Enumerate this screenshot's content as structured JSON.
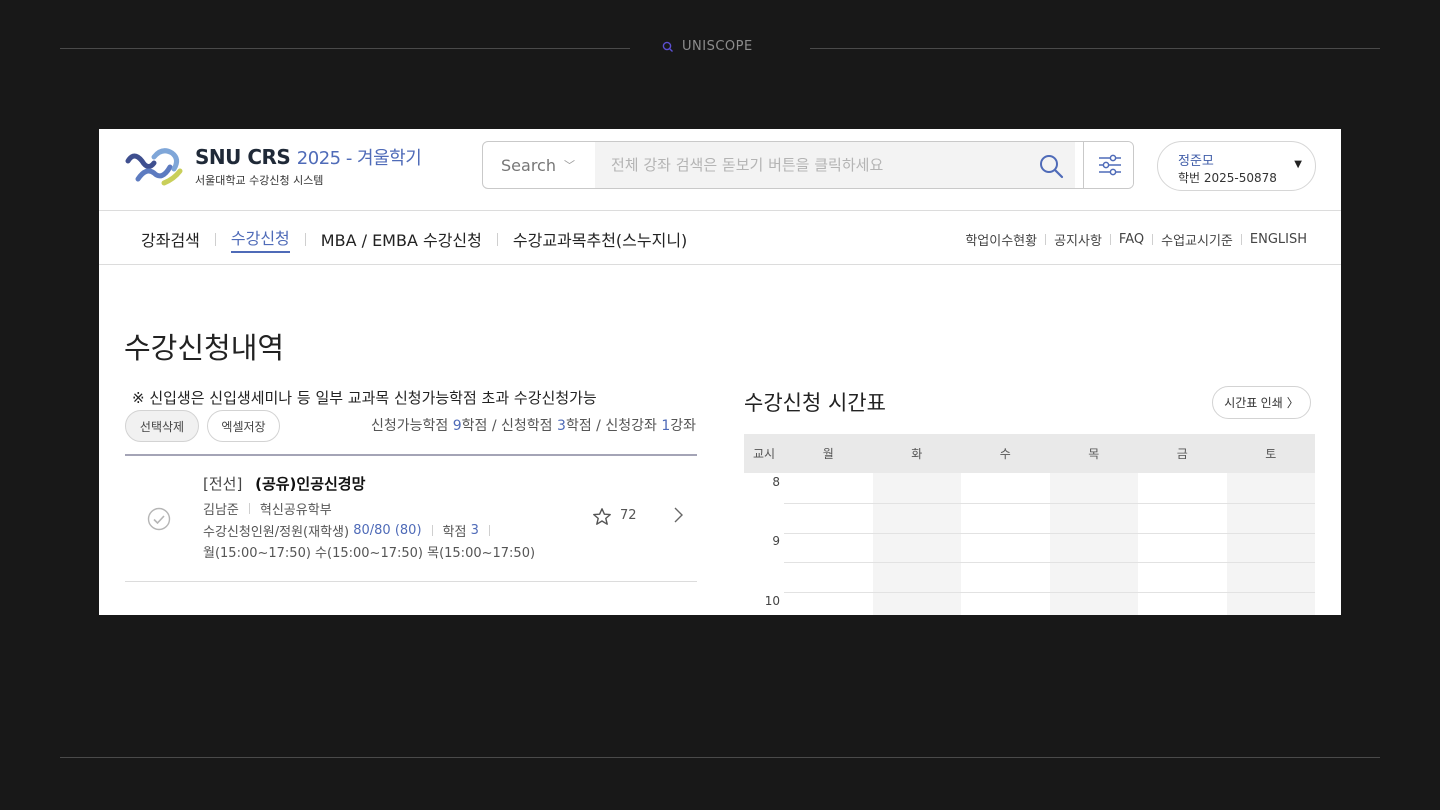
{
  "frame": {
    "brand_label": "UNISCOPE"
  },
  "header": {
    "logo_title": "SNU CRS",
    "term": "2025 - 겨울학기",
    "logo_subtitle": "서울대학교 수강신청 시스템",
    "search": {
      "scope_label": "Search",
      "placeholder": "전체 강좌 검색은 돋보기 버튼을 클릭하세요",
      "value": ""
    },
    "user": {
      "name": "정준모",
      "student_id": "학번 2025-50878"
    }
  },
  "nav": {
    "main_items": [
      "강좌검색",
      "수강신청",
      "MBA / EMBA 수강신청",
      "수강교과목추천(스누지니)"
    ],
    "active_index": 1,
    "util_items": [
      "학업이수현황",
      "공지사항",
      "FAQ",
      "수업교시기준",
      "ENGLISH"
    ]
  },
  "content": {
    "page_title": "수강신청내역",
    "notice": "※ 신입생은 신입생세미나 등 일부 교과목 신청가능학점 초과 수강신청가능",
    "delete_selected_label": "선택삭제",
    "excel_save_label": "엑셀저장",
    "credits": {
      "available_label": "신청가능학점",
      "available_value": "9",
      "applied_label": "신청학점",
      "applied_value": "3",
      "unit_credit": "학점",
      "courses_label": "신청강좌",
      "courses_value": "1",
      "unit_course": "강좌"
    },
    "courses": [
      {
        "kind": "[전선]",
        "name": "(공유)인공신경망",
        "professor": "김남준",
        "department": "혁신공유학부",
        "enroll_label": "수강신청인원/정원(재학생)",
        "enroll_value": "80/80 (80)",
        "credit_label": "학점",
        "credit_value": "3",
        "times": "월(15:00~17:50) 수(15:00~17:50) 목(15:00~17:50)",
        "stars": "72"
      }
    ]
  },
  "timetable": {
    "title": "수강신청 시간표",
    "print_label": "시간표 인쇄",
    "period_header": "교시",
    "days": [
      "월",
      "화",
      "수",
      "목",
      "금",
      "토"
    ],
    "periods": [
      "8",
      "9",
      "10"
    ]
  },
  "colors": {
    "accent": "#4f6bb8",
    "page_background": "#181818"
  }
}
